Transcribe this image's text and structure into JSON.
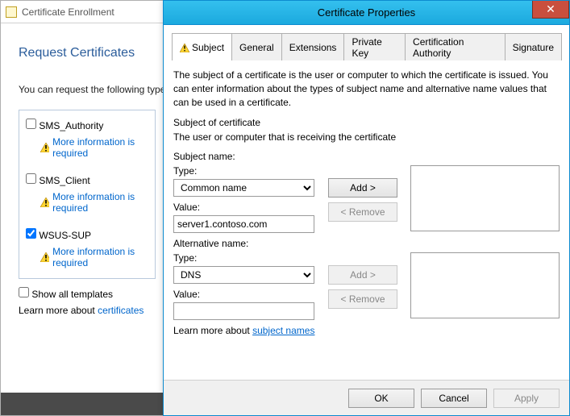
{
  "wizard": {
    "windowTitle": "Certificate Enrollment",
    "heading": "Request Certificates",
    "description": "You can request the following types of certificates. Select the certificates you want to request, and then click Enroll.",
    "templates": [
      {
        "name": "SMS_Authority",
        "checked": false,
        "moreInfo": "More information is required"
      },
      {
        "name": "SMS_Client",
        "checked": false,
        "moreInfo": "More information is required"
      },
      {
        "name": "WSUS-SUP",
        "checked": true,
        "moreInfo": "More information is required"
      }
    ],
    "showAllLabel": "Show all templates",
    "showAllChecked": false,
    "learnText": "Learn more about",
    "learnLink": "certificates"
  },
  "dialog": {
    "title": "Certificate Properties",
    "tabs": [
      "Subject",
      "General",
      "Extensions",
      "Private Key",
      "Certification Authority",
      "Signature"
    ],
    "activeTab": "Subject",
    "intro": "The subject of a certificate is the user or computer to which the certificate is issued. You can enter information about the types of subject name and alternative name values that can be used in a certificate.",
    "subjectCertTitle": "Subject of certificate",
    "subjectCertDesc": "The user or computer that is receiving the certificate",
    "subjectNameLabel": "Subject name:",
    "subjectTypeLabel": "Type:",
    "subjectTypeValue": "Common name",
    "subjectValueLabel": "Value:",
    "subjectValue": "server1.contoso.com",
    "altNameLabel": "Alternative name:",
    "altTypeValue": "DNS",
    "altValue": "",
    "addLabel": "Add >",
    "removeLabel": "< Remove",
    "learnText": "Learn more about",
    "learnLink": "subject names",
    "buttons": {
      "ok": "OK",
      "cancel": "Cancel",
      "apply": "Apply"
    }
  }
}
